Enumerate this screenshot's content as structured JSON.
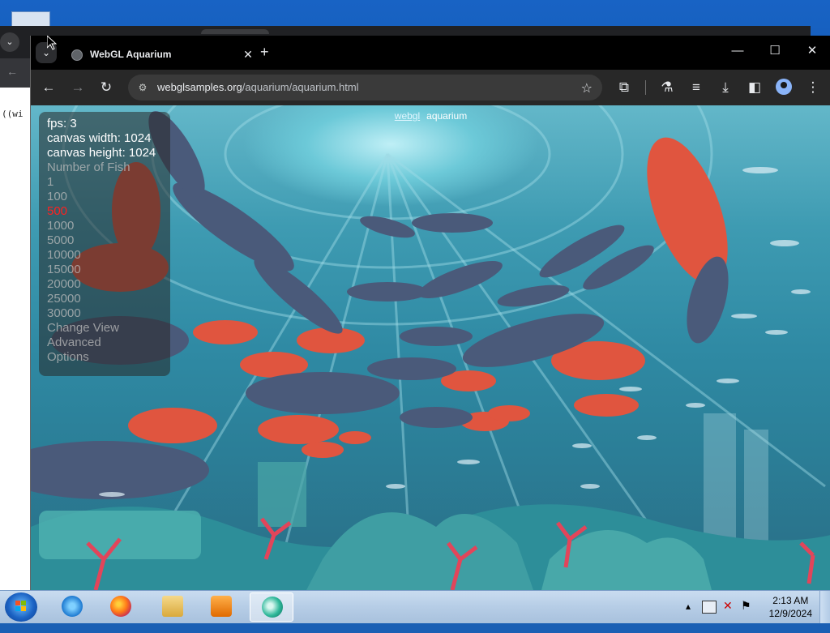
{
  "background_window": {
    "tab_button_icon": "chevron-down-icon",
    "code_snippet": "((wi"
  },
  "browser": {
    "tab": {
      "title": "WebGL Aquarium",
      "close_glyph": "✕"
    },
    "new_tab_glyph": "+",
    "window_controls": {
      "minimize": "—",
      "maximize": "☐",
      "close": "✕"
    },
    "address": {
      "host": "webglsamples.org",
      "path": "/aquarium/aquarium.html"
    },
    "toolbar_icons": [
      "back-icon",
      "forward-icon",
      "reload-icon",
      "site-info-icon",
      "bookmark-star-icon",
      "extensions-icon",
      "labs-icon",
      "media-controls-icon",
      "downloads-icon",
      "side-panel-icon",
      "profile-icon",
      "menu-icon"
    ]
  },
  "page": {
    "header_link": "webgl",
    "header_title": "aquarium",
    "stats": {
      "fps": "fps: 3",
      "canvas_width": "canvas width: 1024",
      "canvas_height": "canvas height: 1024"
    },
    "menu": {
      "heading": "Number of Fish",
      "counts": [
        "1",
        "100",
        "500",
        "1000",
        "5000",
        "10000",
        "15000",
        "20000",
        "25000",
        "30000"
      ],
      "selected": "500",
      "change_view": "Change View",
      "advanced": "Advanced",
      "options": "Options"
    }
  },
  "taskbar": {
    "apps": [
      "start-button",
      "internet-explorer-icon",
      "firefox-icon",
      "file-explorer-icon",
      "media-player-icon",
      "chrome-like-app-icon"
    ],
    "tray_icons": [
      "show-hidden-icons-icon",
      "network-icon",
      "volume-muted-icon",
      "action-center-flag-icon"
    ],
    "time": "2:13 AM",
    "date": "12/9/2024"
  },
  "colors": {
    "selected_menu": "#ff2020",
    "taskbar": "#b6cde6",
    "chrome_toolbar": "#282828"
  }
}
